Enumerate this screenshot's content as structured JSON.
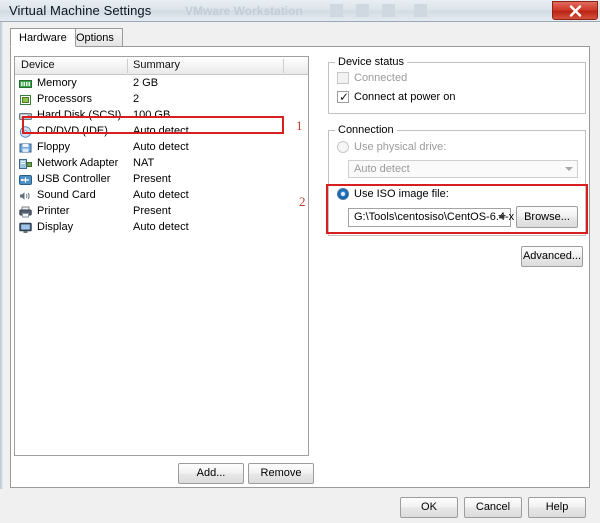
{
  "window": {
    "title": "Virtual Machine Settings",
    "ghost_title": "VMware Workstation",
    "close_icon": "close-icon"
  },
  "tabs": [
    {
      "label": "Hardware",
      "active": true
    },
    {
      "label": "Options",
      "active": false
    }
  ],
  "device_list": {
    "columns": [
      "Device",
      "Summary"
    ],
    "rows": [
      {
        "device": "Memory",
        "summary": "2 GB",
        "icon": "memory-icon"
      },
      {
        "device": "Processors",
        "summary": "2",
        "icon": "cpu-icon"
      },
      {
        "device": "Hard Disk (SCSI)",
        "summary": "100 GB",
        "icon": "harddisk-icon"
      },
      {
        "device": "CD/DVD (IDE)",
        "summary": "Auto detect",
        "icon": "cddvd-icon"
      },
      {
        "device": "Floppy",
        "summary": "Auto detect",
        "icon": "floppy-icon"
      },
      {
        "device": "Network Adapter",
        "summary": "NAT",
        "icon": "network-icon"
      },
      {
        "device": "USB Controller",
        "summary": "Present",
        "icon": "usb-icon"
      },
      {
        "device": "Sound Card",
        "summary": "Auto detect",
        "icon": "sound-icon"
      },
      {
        "device": "Printer",
        "summary": "Present",
        "icon": "printer-icon"
      },
      {
        "device": "Display",
        "summary": "Auto detect",
        "icon": "display-icon"
      }
    ],
    "add_label": "Add...",
    "remove_label": "Remove"
  },
  "device_status": {
    "group_label": "Device status",
    "connected": {
      "label": "Connected",
      "checked": false,
      "enabled": false
    },
    "connect_at_power_on": {
      "label": "Connect at power on",
      "checked": true,
      "enabled": true,
      "check_glyph": "✓"
    }
  },
  "connection": {
    "group_label": "Connection",
    "use_physical_drive": {
      "label": "Use physical drive:",
      "selected": false,
      "enabled": false
    },
    "physical_drive_value": "Auto detect",
    "use_iso_image": {
      "label": "Use ISO image file:",
      "selected": true,
      "enabled": true
    },
    "iso_path_value": "G:\\Tools\\centosiso\\CentOS-6.4-x",
    "browse_label": "Browse...",
    "advanced_label": "Advanced..."
  },
  "annotations": [
    {
      "number": "1",
      "target": "cd-dvd-row"
    },
    {
      "number": "2",
      "target": "use-iso-image-section"
    }
  ],
  "footer": {
    "ok_label": "OK",
    "cancel_label": "Cancel",
    "help_label": "Help"
  },
  "colors": {
    "annotation_red": "#d81f1f",
    "close_red": "#cf3b2b",
    "radio_blue": "#1565b0"
  }
}
